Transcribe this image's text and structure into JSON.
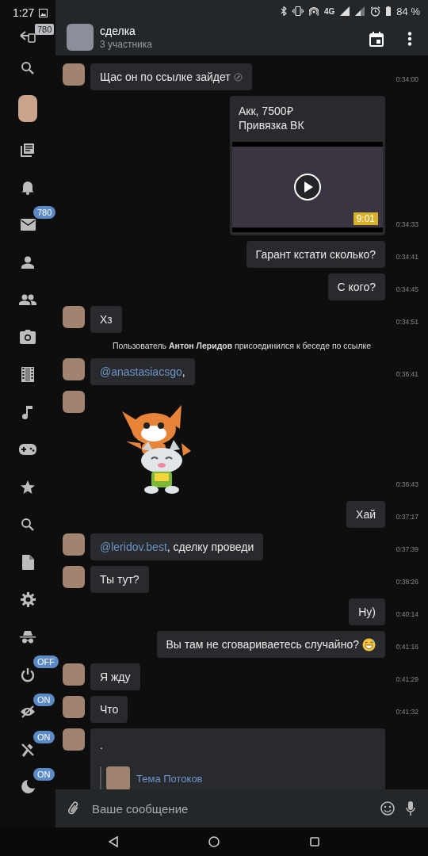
{
  "status_bar": {
    "time": "1:27",
    "network": "4G",
    "battery": "84 %"
  },
  "sidebar": {
    "items": [
      {
        "kind": "back",
        "badge": "780",
        "badge_muted": true
      },
      {
        "kind": "search"
      },
      {
        "kind": "avatar"
      },
      {
        "kind": "news"
      },
      {
        "kind": "bell"
      },
      {
        "kind": "mail",
        "badge": "780",
        "badge_muted": false
      },
      {
        "kind": "person"
      },
      {
        "kind": "people"
      },
      {
        "kind": "camera"
      },
      {
        "kind": "film"
      },
      {
        "kind": "music"
      },
      {
        "kind": "gamepad"
      },
      {
        "kind": "star"
      },
      {
        "kind": "search"
      },
      {
        "kind": "file"
      },
      {
        "kind": "gear"
      },
      {
        "kind": "spy"
      },
      {
        "kind": "power",
        "badge": "OFF",
        "badge_muted": false
      },
      {
        "kind": "eye-off",
        "badge": "ON",
        "badge_muted": false
      },
      {
        "kind": "pin",
        "badge": "ON",
        "badge_muted": false
      },
      {
        "kind": "moon",
        "badge": "ON",
        "badge_muted": false
      }
    ]
  },
  "header": {
    "title": "сделка",
    "subtitle": "3 участника"
  },
  "messages": [
    {
      "kind": "in",
      "text": "Щас он по ссылке зайдет",
      "edited": true,
      "time": "0:34:00"
    },
    {
      "kind": "media",
      "text": "Акк, 7500₽\nПривязка ВК",
      "duration": "9:01",
      "time": "0:34:33"
    },
    {
      "kind": "out",
      "text": "Гарант кстати сколько?",
      "time": "0:34:41"
    },
    {
      "kind": "out",
      "text": "С кого?",
      "time": "0:34:45"
    },
    {
      "kind": "in",
      "text": "Хз",
      "time": "0:34:51"
    },
    {
      "kind": "system",
      "text": "Пользователь **Антон Леридов** присоединился к беседе по ссылке"
    },
    {
      "kind": "in",
      "mention": "@anastasiacsgo",
      "text": ",",
      "time": "0:36:41"
    },
    {
      "kind": "sticker",
      "time": "0:36:43"
    },
    {
      "kind": "out",
      "text": "Хай",
      "time": "0:37:17"
    },
    {
      "kind": "in",
      "mention": "@leridov.best",
      "text": ", сделку проведи",
      "time": "0:37:39"
    },
    {
      "kind": "in",
      "text": "Ты тут?",
      "time": "0:38:26"
    },
    {
      "kind": "out",
      "text": "Ну)",
      "time": "0:40:14"
    },
    {
      "kind": "out",
      "text": "Вы там не сговариваетесь случайно?",
      "emoji": true,
      "time": "0:41:16"
    },
    {
      "kind": "in",
      "text": "Я жду",
      "time": "0:41:29"
    },
    {
      "kind": "in",
      "text": "Что",
      "time": "0:41:32"
    },
    {
      "kind": "reply",
      "text": ".",
      "reply_name": "Тема Потоков"
    }
  ],
  "composer": {
    "placeholder": "Ваше сообщение"
  }
}
